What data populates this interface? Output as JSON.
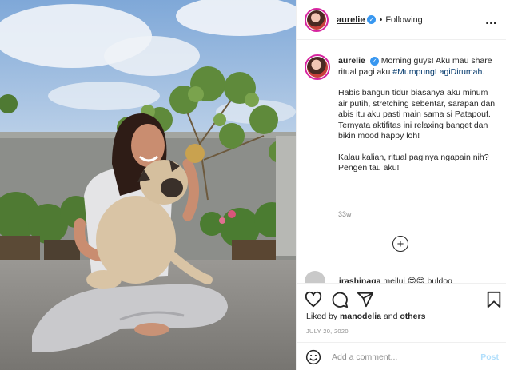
{
  "header": {
    "username": "aurelie",
    "verified_mark": "✓",
    "separator": "•",
    "follow_status": "Following",
    "more_label": "..."
  },
  "caption": {
    "username": "aurelie",
    "text_line1": "Morning guys! Aku mau share ritual pagi aku",
    "hashtag": "#MumpungLagiDirumah",
    "hashtag_suffix": ".",
    "paragraph2": "Habis bangun tidur biasanya aku minum air putih, stretching sebentar, sarapan dan abis itu aku pasti main sama si Patapouf. Ternyata aktifitas ini relaxing banget dan bikin mood happy loh!",
    "paragraph3": "Kalau kalian, ritual paginya ngapain nih? Pengen tau aku!",
    "time_ago": "33w"
  },
  "load_more": {
    "icon": "plus-circle-icon",
    "label": "+"
  },
  "next_comment": {
    "username": "irashinaga",
    "text": "meilui 😍😍 buldog"
  },
  "actions": {
    "like_icon": "heart-icon",
    "comment_icon": "comment-icon",
    "share_icon": "share-icon",
    "save_icon": "bookmark-icon"
  },
  "likes": {
    "prefix": "Liked by ",
    "user": "manodelia",
    "middle": " and ",
    "others": "others"
  },
  "post_date": "JULY 20, 2020",
  "comment_box": {
    "emoji_icon": "emoji-icon",
    "placeholder": "Add a comment...",
    "post_label": "Post"
  },
  "colors": {
    "accent_link": "#00376b",
    "verified": "#3897f0",
    "post_disabled": "#b2dffc",
    "border": "#efefef",
    "muted": "#8e8e8e"
  }
}
